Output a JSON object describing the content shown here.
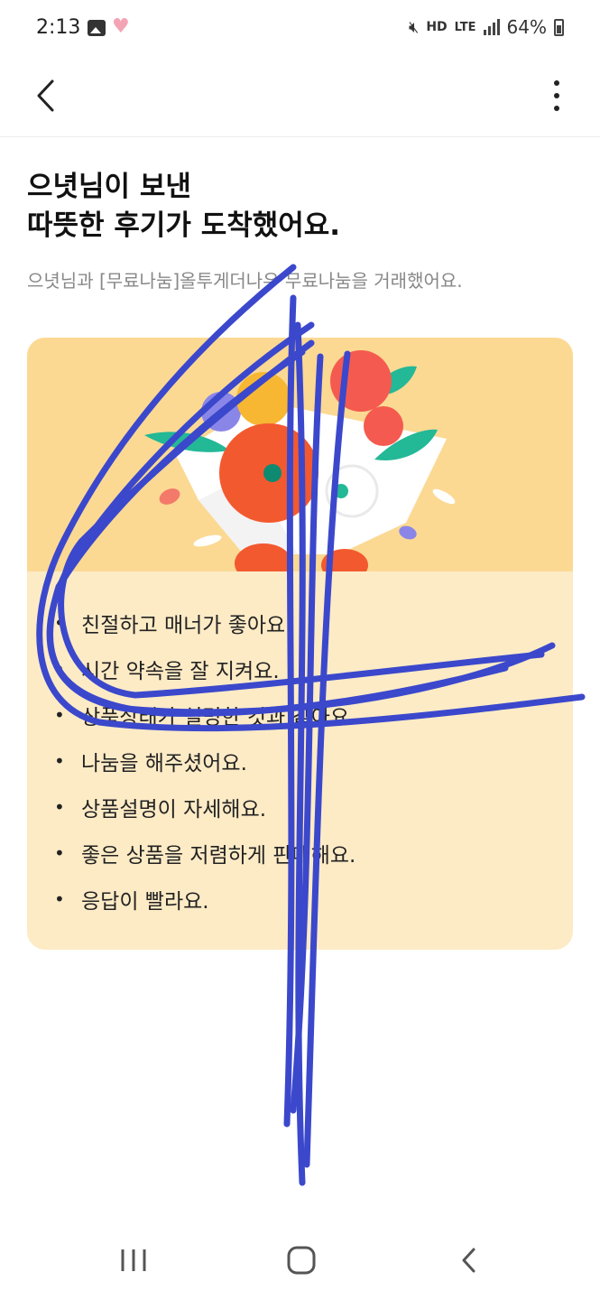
{
  "status_bar": {
    "time": "2:13",
    "hd_label": "HD",
    "lte_label": "LTE",
    "battery": "64%",
    "icons": [
      "gallery-icon",
      "heart-icon",
      "mute-icon",
      "signal-icon",
      "battery-icon"
    ]
  },
  "app_bar": {
    "back_icon": "chevron-left-icon",
    "menu_icon": "more-vertical-icon"
  },
  "headline": {
    "line1": "으녓님이 보낸",
    "line2": "따뜻한 후기가 도착했어요."
  },
  "subline": "으녓님과 [무료나눔]올투게더나우 무료나눔을 거래했어요.",
  "card": {
    "illustration": "flower-bouquet-illustration",
    "reviews": [
      "친절하고 매너가 좋아요.",
      "시간 약속을 잘 지켜요.",
      "상품상태가 설명한 것과 같아요.",
      "나눔을 해주셨어요.",
      "상품설명이 자세해요.",
      "좋은 상품을 저렴하게 판매해요.",
      "응답이 빨라요."
    ]
  },
  "nav_bar": {
    "icons": [
      "recent-apps-icon",
      "home-icon",
      "back-icon"
    ]
  },
  "colors": {
    "card_background": "#fdebc6",
    "illustration_background": "#fbd993",
    "scribble": "#3b48cc",
    "subtext": "#888888"
  }
}
